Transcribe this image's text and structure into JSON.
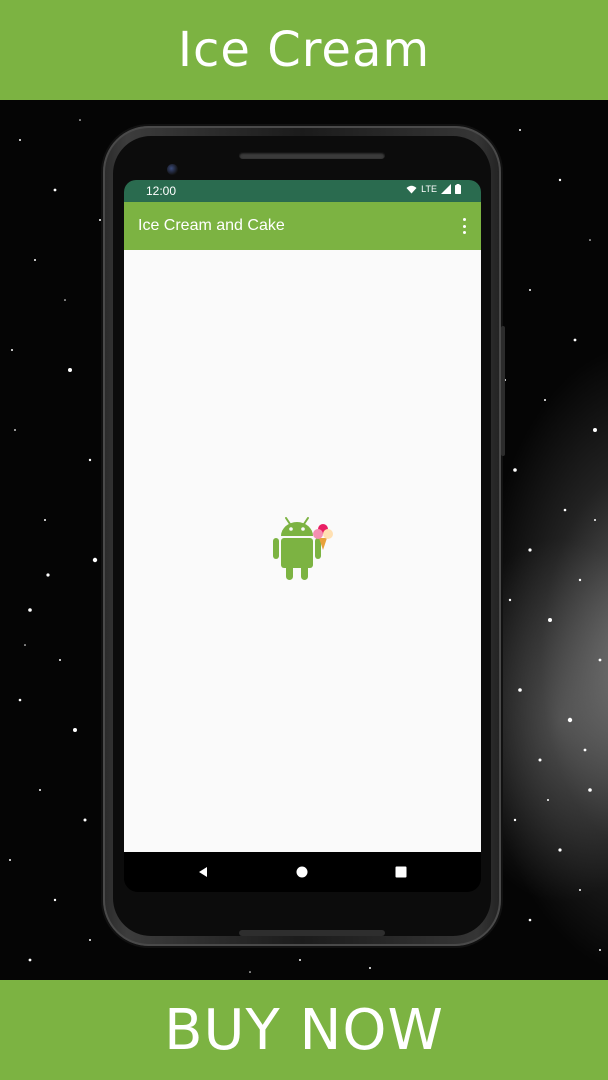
{
  "banner": {
    "title": "Ice Cream",
    "cta_label": "BUY NOW",
    "color": "#7cb342"
  },
  "phone": {
    "status_bar": {
      "time": "12:00",
      "network": "LTE",
      "color": "#2a6b4f"
    },
    "app_bar": {
      "title": "Ice Cream and Cake",
      "color": "#7cb342",
      "menu_icon": "overflow-menu-icon"
    },
    "content": {
      "icon": "android-ice-cream-icon"
    },
    "nav_bar": {
      "buttons": [
        "back-icon",
        "home-icon",
        "recents-icon"
      ]
    }
  }
}
